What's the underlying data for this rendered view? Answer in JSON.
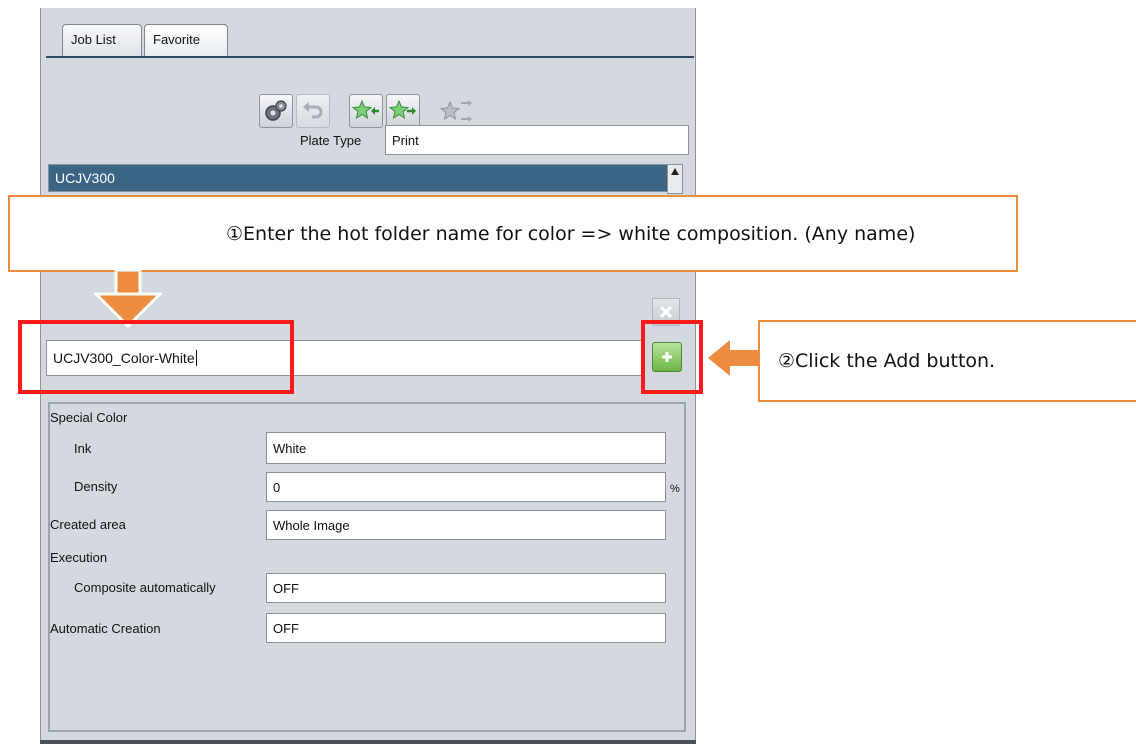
{
  "tabs": [
    {
      "label": "Job List",
      "active": false
    },
    {
      "label": "Favorite",
      "active": true
    }
  ],
  "toolbar": {
    "icons": [
      "gears-icon",
      "undo-icon",
      "star-import-icon",
      "star-export-icon",
      "star-share-icon"
    ]
  },
  "plate_type": {
    "label": "Plate Type",
    "value": "Print"
  },
  "hot_folder_list": {
    "selected": "UCJV300"
  },
  "new_folder_input": {
    "value": "UCJV300_Color-White"
  },
  "buttons": {
    "delete_icon": "close-icon",
    "add_icon": "plus-icon"
  },
  "properties": {
    "special_color": {
      "label": "Special Color"
    },
    "ink": {
      "label": "Ink",
      "value": "White"
    },
    "density": {
      "label": "Density",
      "value": "0",
      "unit": "%"
    },
    "created_area": {
      "label": "Created area",
      "value": "Whole Image"
    },
    "execution": {
      "label": "Execution"
    },
    "composite_automatically": {
      "label": "Composite automatically",
      "value": "OFF"
    },
    "automatic_creation": {
      "label": "Automatic Creation",
      "value": "OFF"
    }
  },
  "callouts": {
    "step1": "①Enter the hot folder name for color => white composition. (Any name)",
    "step2": "②Click the Add button."
  },
  "colors": {
    "accent_orange": "#ed8b3e",
    "highlight_red": "#ff1a1a",
    "selection_blue": "#3a6585",
    "panel": "#d4d9e0"
  }
}
